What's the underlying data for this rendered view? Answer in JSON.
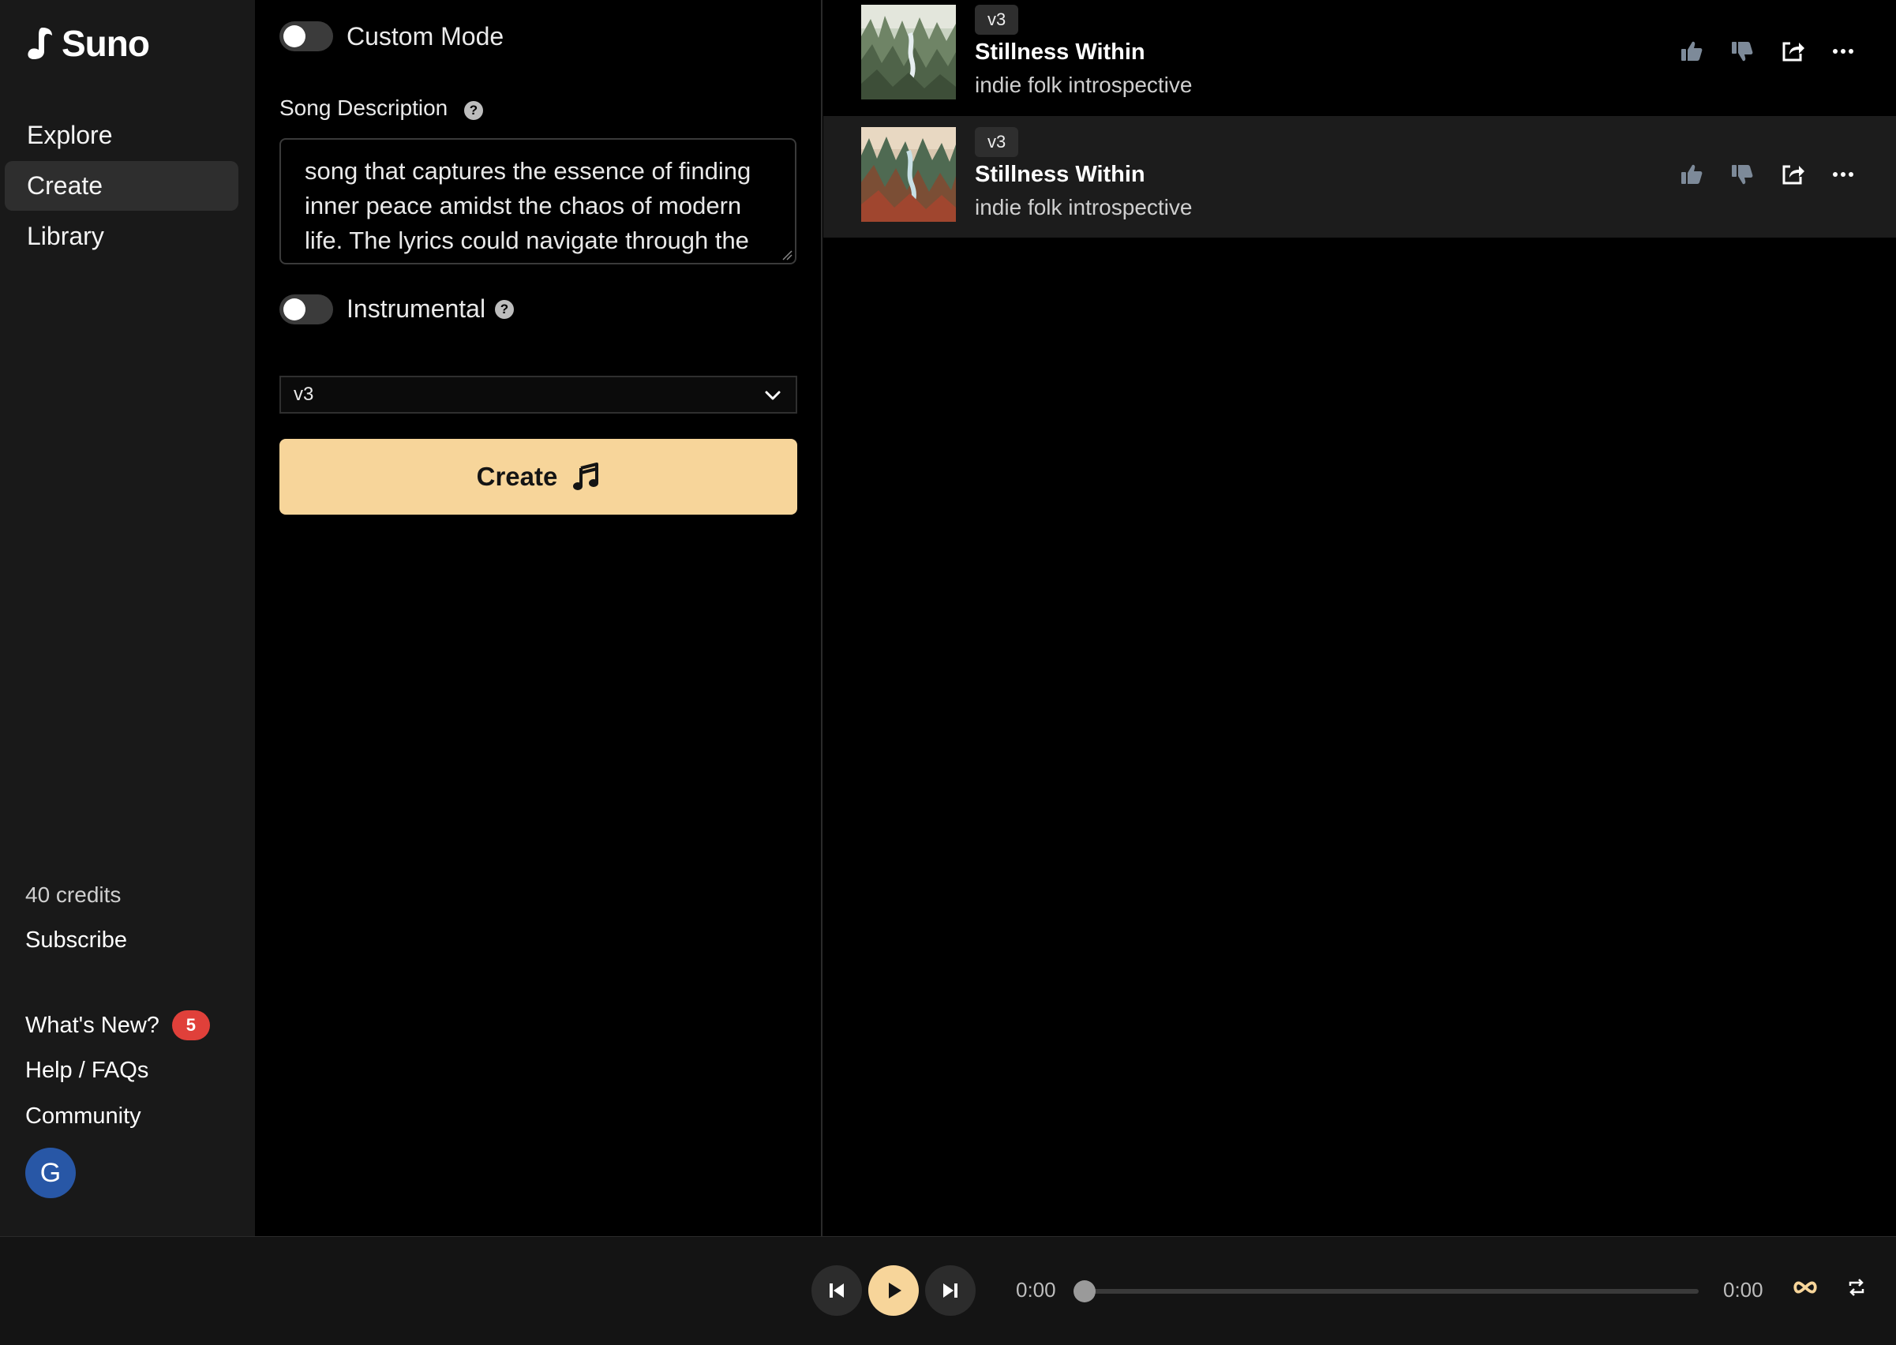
{
  "app": {
    "name": "Suno"
  },
  "sidebar": {
    "nav": [
      {
        "label": "Explore",
        "active": false
      },
      {
        "label": "Create",
        "active": true
      },
      {
        "label": "Library",
        "active": false
      }
    ],
    "credits": "40 credits",
    "subscribe": "Subscribe",
    "whats_new": {
      "label": "What's New?",
      "badge": "5"
    },
    "help": "Help / FAQs",
    "community": "Community",
    "avatar_initial": "G"
  },
  "create_panel": {
    "custom_mode": {
      "label": "Custom Mode",
      "on": false
    },
    "description": {
      "label": "Song Description",
      "value": "song that captures the essence of finding inner peace amidst the chaos of modern life. The lyrics could navigate through the"
    },
    "instrumental": {
      "label": "Instrumental",
      "on": false
    },
    "model_select": {
      "value": "v3"
    },
    "create_button": "Create"
  },
  "songs": [
    {
      "version": "v3",
      "title": "Stillness Within",
      "tags": "indie folk introspective",
      "selected": false
    },
    {
      "version": "v3",
      "title": "Stillness Within",
      "tags": "indie folk introspective",
      "selected": true
    }
  ],
  "player": {
    "current_time": "0:00",
    "duration": "0:00",
    "progress": 0
  },
  "colors": {
    "accent": "#f7d59a",
    "badge": "#e0403a",
    "avatar": "#2857a6",
    "sidebar_bg": "#191919"
  }
}
